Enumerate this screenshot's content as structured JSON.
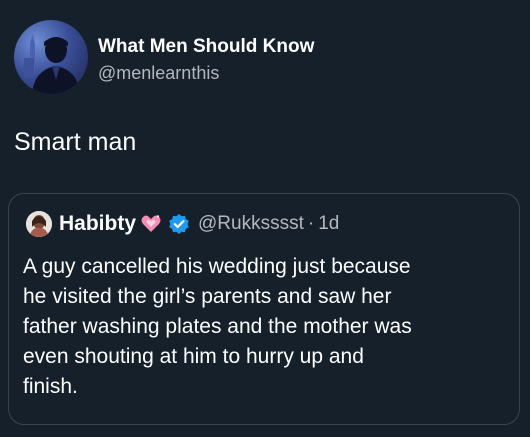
{
  "tweet": {
    "author_name": "What Men Should Know",
    "author_handle": "@menlearnthis",
    "text": "Smart man"
  },
  "quoted_tweet": {
    "author_name": "Habibty",
    "heart_icon": "sparkling-heart-icon",
    "verified_icon": "verified-badge-icon",
    "author_handle": "@Rukksssst",
    "separator": "·",
    "time": "1d",
    "lines": [
      "A guy cancelled his wedding just because",
      "he visited the girl’s parents and saw  her",
      "father washing plates and the mother was",
      "even shouting at him to hurry up and",
      "finish."
    ]
  },
  "colors": {
    "background": "#15202b",
    "text_primary": "#ffffff",
    "text_secondary": "#b3b8be",
    "verified_blue": "#1d9bf0",
    "heart_pink": "#f68bb4",
    "border": "#3a4450"
  }
}
